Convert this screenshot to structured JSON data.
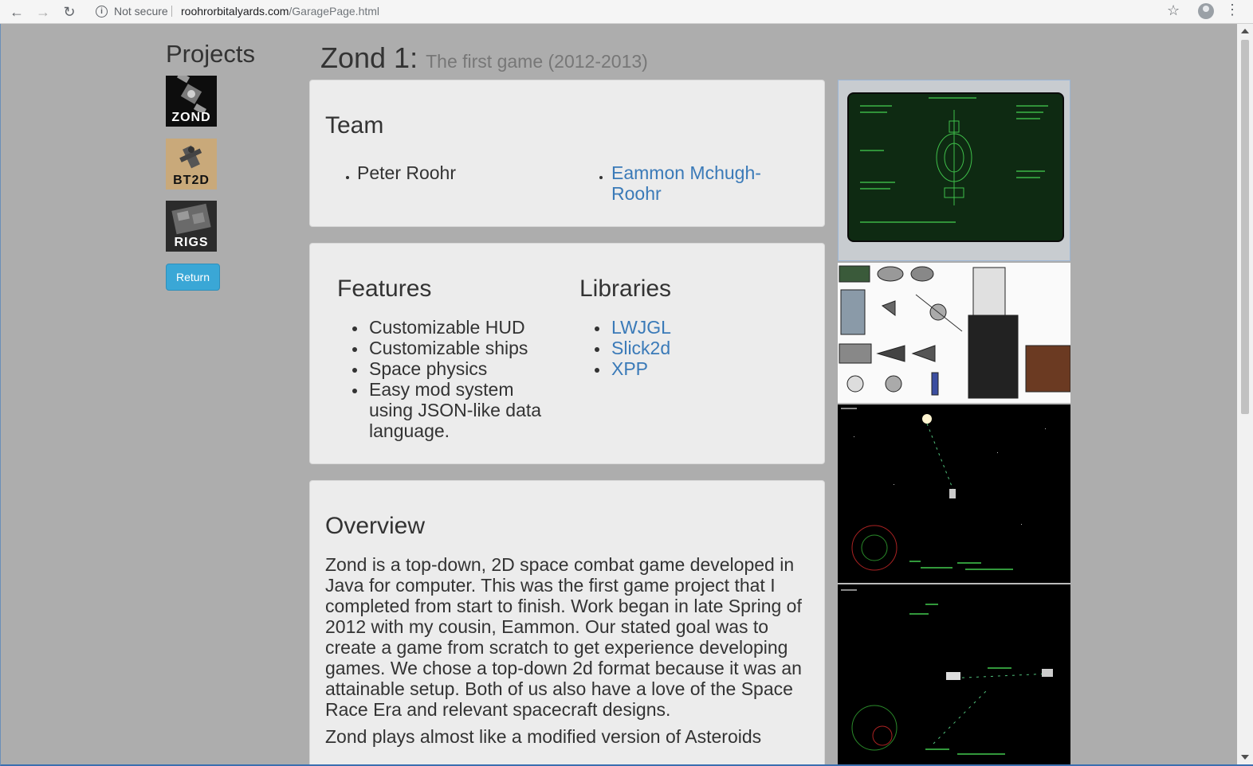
{
  "browser": {
    "security_label": "Not secure",
    "url_host": "roohrorbitalyards.com",
    "url_path": "/GaragePage.html"
  },
  "sidebar": {
    "title": "Projects",
    "projects": [
      {
        "label": "ZOND"
      },
      {
        "label": "BT2D"
      },
      {
        "label": "RIGS"
      }
    ],
    "return_label": "Return"
  },
  "header": {
    "title": "Zond 1:",
    "subtitle": "The first game (2012-2013)"
  },
  "team": {
    "heading": "Team",
    "members": [
      "Peter Roohr",
      "Eammon Mchugh-",
      "Roohr"
    ]
  },
  "features": {
    "heading": "Features",
    "items": [
      "Customizable HUD",
      "Customizable ships",
      "Space physics",
      "Easy mod system",
      "using JSON-like data",
      "language."
    ]
  },
  "libraries": {
    "heading": "Libraries",
    "items": [
      "LWJGL",
      "Slick2d",
      "XPP"
    ]
  },
  "overview": {
    "heading": "Overview",
    "paragraphs": [
      "Zond is a top-down, 2D space combat game developed in Java for computer. This was the first game project that I completed from start to finish. Work began in late Spring of 2012 with my cousin, Eammon. Our stated goal was to create a game from scratch to get experience developing games. We chose a top-down 2d format because it was an attainable setup. Both of us also have a love of the Space Race Era and relevant spacecraft designs.",
      "Zond plays almost like a modified version of Asteroids"
    ]
  },
  "colors": {
    "background": "#adadad",
    "card": "#ececec",
    "link": "#3a7ab8",
    "button": "#3aa7d6"
  }
}
